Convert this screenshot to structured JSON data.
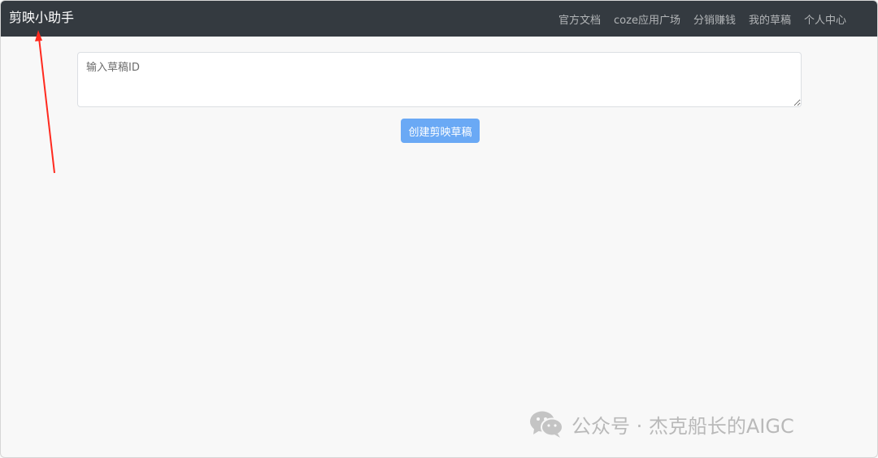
{
  "navbar": {
    "brand": "剪映小助手",
    "links": [
      "官方文档",
      "coze应用广场",
      "分销赚钱",
      "我的草稿",
      "个人中心"
    ]
  },
  "draft_input": {
    "placeholder": "输入草稿ID"
  },
  "create_button": {
    "label": "创建剪映草稿"
  },
  "watermark": {
    "text": "公众号 · 杰克船长的AIGC",
    "icon": "wechat-icon"
  },
  "annotation": {
    "color": "#ff2a1f"
  },
  "colors": {
    "navbar": "#343a40",
    "button": "#6aa9f5",
    "background": "#f8f8f8"
  }
}
